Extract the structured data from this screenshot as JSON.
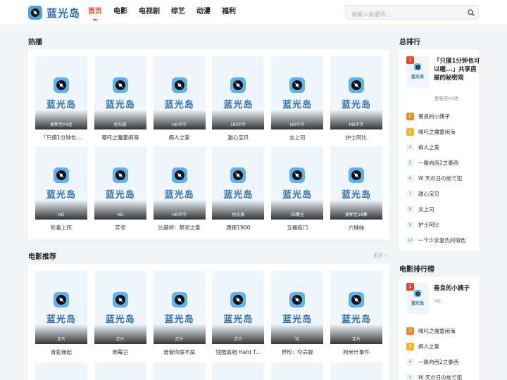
{
  "header": {
    "logo_text": "蓝光岛",
    "nav": [
      "首页",
      "电影",
      "电视剧",
      "综艺",
      "动漫",
      "福利"
    ],
    "search_placeholder": "请输入关键词..."
  },
  "hot": {
    "title": "热播",
    "items": [
      {
        "title": "「只摸1分钟也...",
        "badge": "更新至04话"
      },
      {
        "title": "哪吒之魔童闹海",
        "badge": "抢先版"
      },
      {
        "title": "痴人之爱",
        "badge": "HD中字"
      },
      {
        "title": "甜心宝贝",
        "badge": "HD中字"
      },
      {
        "title": "女上司",
        "badge": "HD中字"
      },
      {
        "title": "护士阿比",
        "badge": "HD中字"
      },
      {
        "title": "轮番上阵",
        "badge": "HD"
      },
      {
        "title": "芳邻",
        "badge": "HD"
      },
      {
        "title": "比赫特：禁忌之爱",
        "badge": "HD中字"
      },
      {
        "title": "唐探1900",
        "badge": "抢先版"
      },
      {
        "title": "五福临门",
        "badge": "36集全"
      },
      {
        "title": "六姊妹",
        "badge": "更新至18集"
      }
    ]
  },
  "movies": {
    "title": "电影推荐",
    "more": "更多",
    "items": [
      {
        "title": "青蛇缘起",
        "badge": "正片"
      },
      {
        "title": "倒霉日",
        "badge": "正片"
      },
      {
        "title": "谁管你屎不屎",
        "badge": "正片"
      },
      {
        "title": "残酷真相 Hard T...",
        "badge": "正片"
      },
      {
        "title": "异形：夺命舰",
        "badge": "TC"
      },
      {
        "title": "阿米什事件",
        "badge": "正片"
      }
    ]
  },
  "ranking": {
    "title": "总排行",
    "top": {
      "num": "1",
      "title": "「只摸1分钟也可以喔...」共享房屋的秘密规",
      "sub": "更新至04话"
    },
    "list": [
      {
        "num": "2",
        "title": "善良的小姨子"
      },
      {
        "num": "3",
        "title": "哪吒之魔童闹海"
      },
      {
        "num": "4",
        "title": "痴人之爱"
      },
      {
        "num": "5",
        "title": "一路向西2之泰西"
      },
      {
        "num": "6",
        "title": "W 天の日の前で犯"
      },
      {
        "num": "7",
        "title": "甜心宝贝"
      },
      {
        "num": "8",
        "title": "女上司"
      },
      {
        "num": "9",
        "title": "护士阿比"
      },
      {
        "num": "10",
        "title": "一个少女复仇的情色"
      }
    ]
  },
  "movie_ranking": {
    "title": "电影排行榜",
    "top": {
      "num": "1",
      "title": "善良的小姨子",
      "sub": "HD"
    },
    "list": [
      {
        "num": "2",
        "title": "哪吒之魔童闹海"
      },
      {
        "num": "3",
        "title": "痴人之爱"
      },
      {
        "num": "4",
        "title": "一路向西2之泰西"
      },
      {
        "num": "5",
        "title": "W 天の日の前で犯"
      }
    ]
  },
  "thumb_label": "蓝光岛",
  "colors": {
    "accent": "#e5462d",
    "brand": "#2d6fb4"
  }
}
